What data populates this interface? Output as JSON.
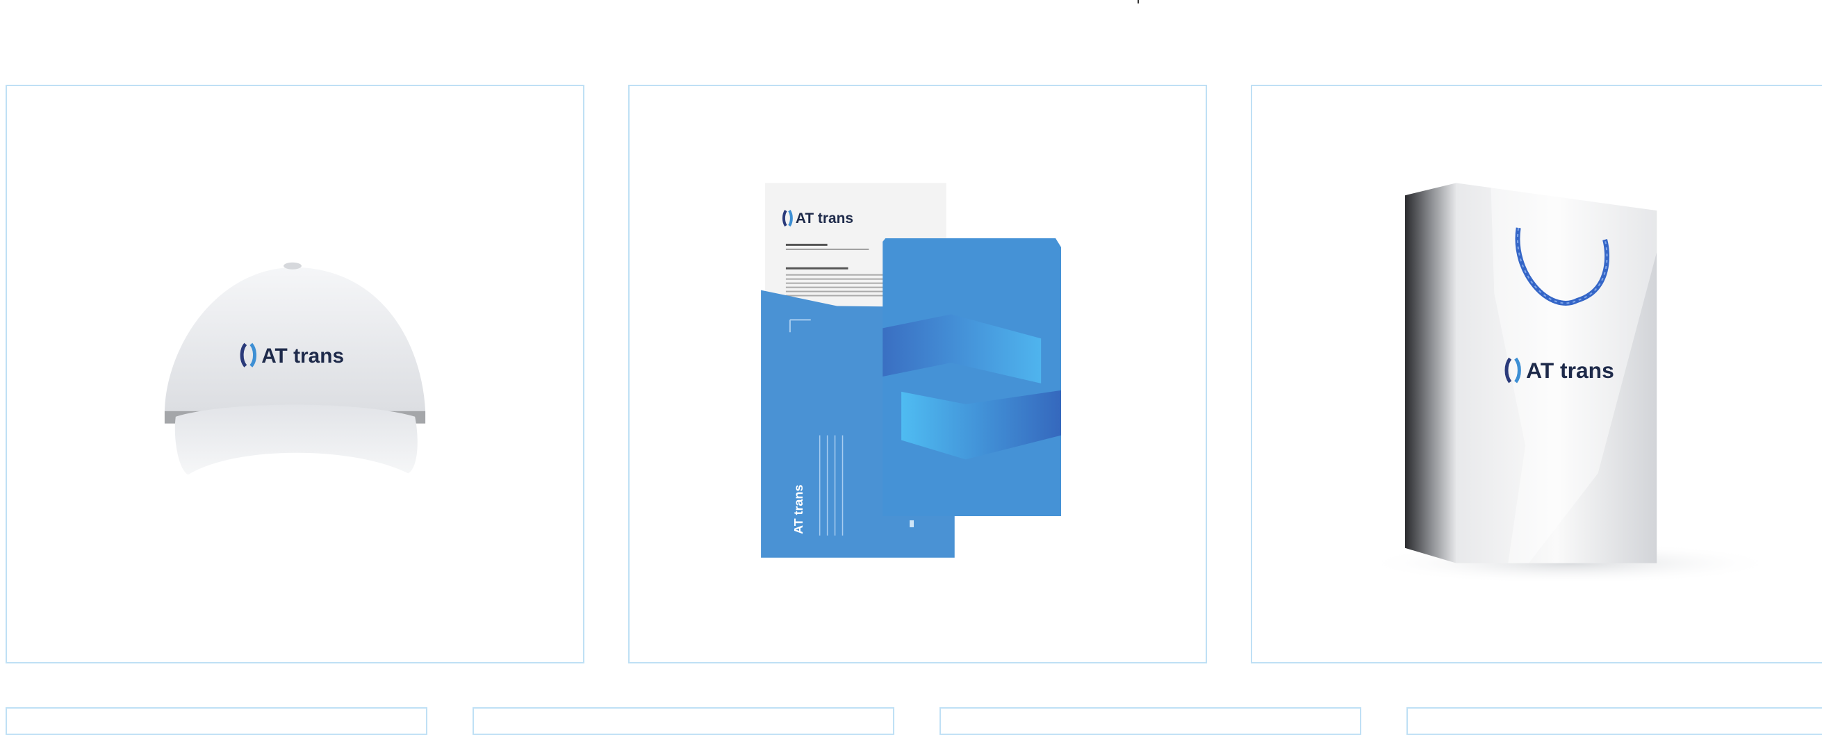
{
  "brand": {
    "name": "AT trans",
    "colors": {
      "accent": "#3d8fd4",
      "dark": "#1e2a4a",
      "border": "#bfe0f5"
    }
  },
  "gallery": {
    "items": [
      {
        "name": "cap",
        "logo": "AT trans",
        "icon": "cap-mockup"
      },
      {
        "name": "stationery",
        "logo": "AT trans",
        "icon": "envelope-mockup"
      },
      {
        "name": "bag",
        "logo": "AT trans",
        "icon": "bag-mockup"
      }
    ]
  }
}
